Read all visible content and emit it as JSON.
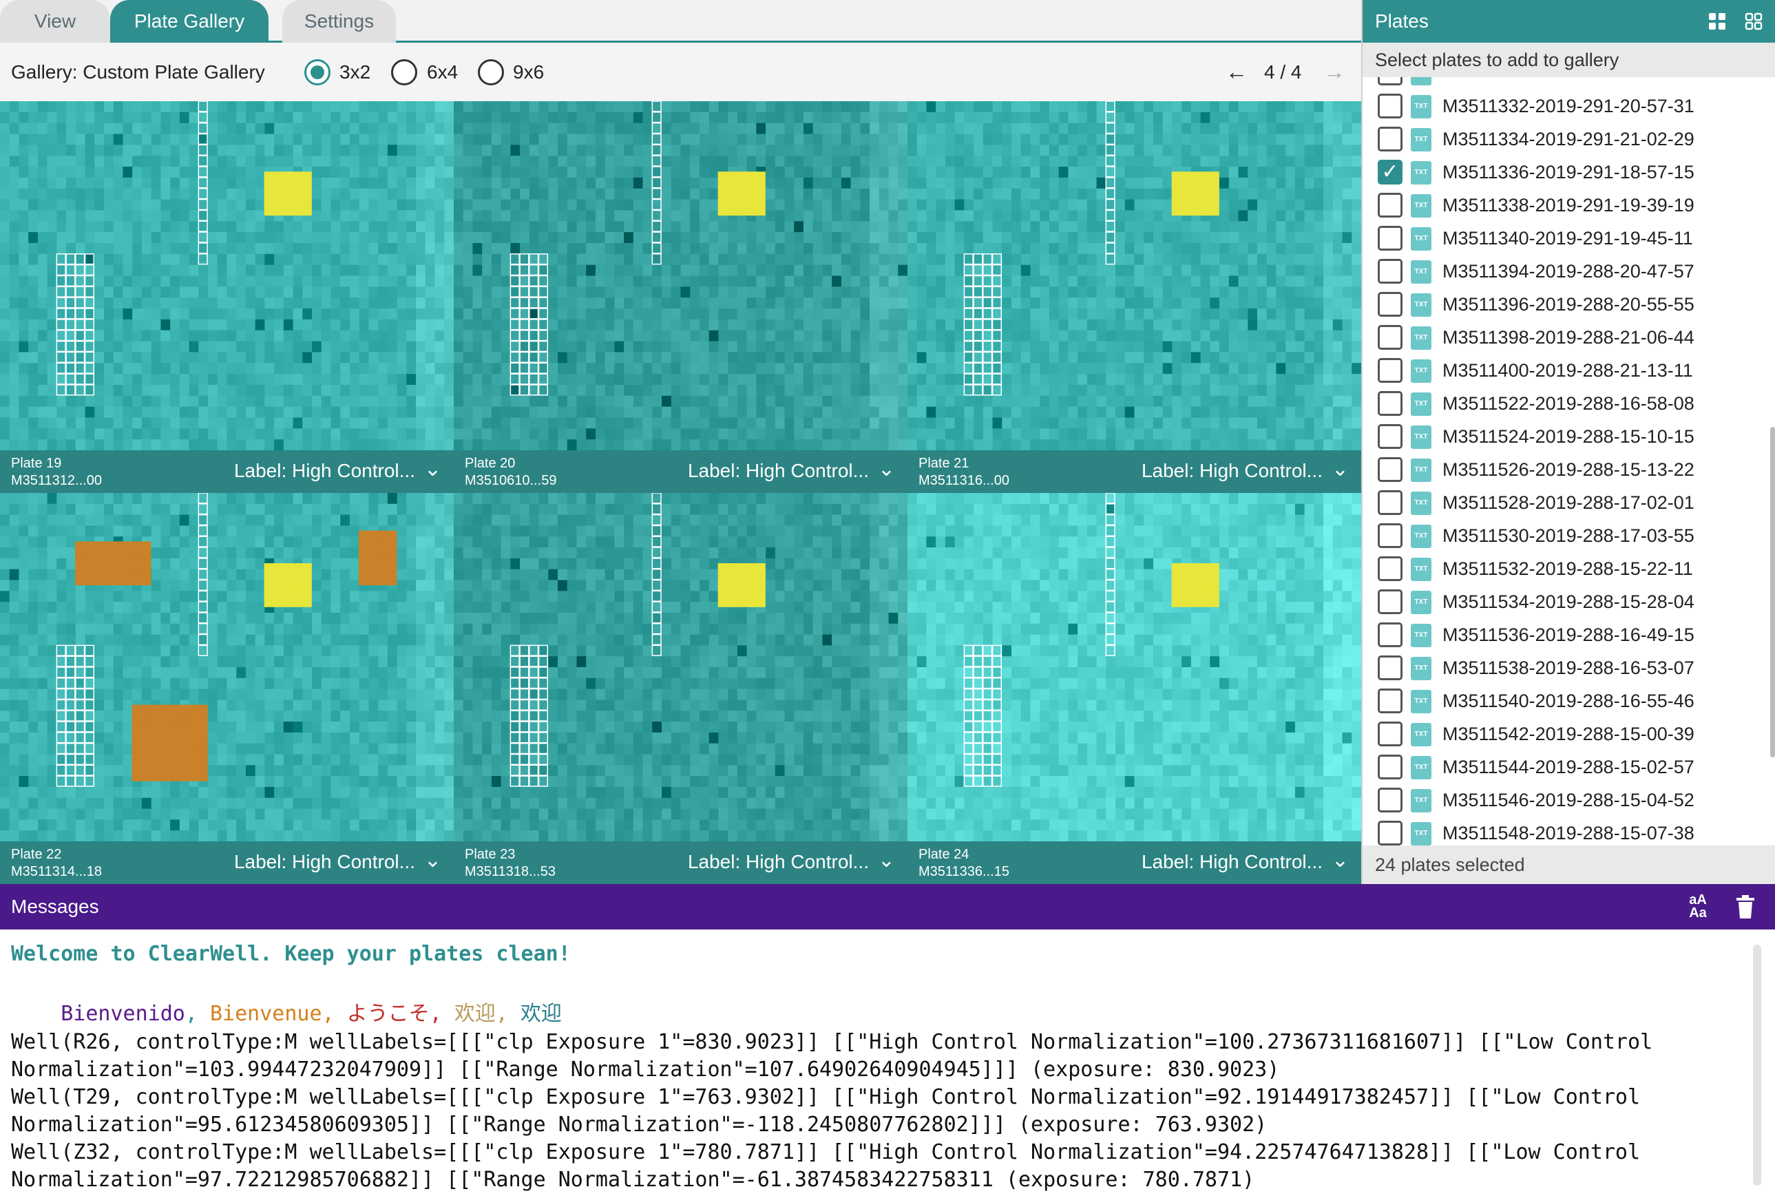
{
  "tabs": [
    {
      "label": "View",
      "active": false
    },
    {
      "label": "Plate Gallery",
      "active": true
    },
    {
      "label": "Settings",
      "active": false
    }
  ],
  "gallery": {
    "title": "Gallery: Custom Plate Gallery",
    "layouts": [
      {
        "label": "3x2",
        "selected": true
      },
      {
        "label": "6x4",
        "selected": false
      },
      {
        "label": "9x6",
        "selected": false
      }
    ],
    "page": "4 / 4"
  },
  "plates_grid": [
    {
      "name": "Plate 19",
      "id": "M3511312...00",
      "label": "Label: High Control...",
      "tone": "normal",
      "marks": [
        "yellow"
      ]
    },
    {
      "name": "Plate 20",
      "id": "M3510610...59",
      "label": "Label: High Control...",
      "tone": "dark",
      "marks": [
        "yellow"
      ]
    },
    {
      "name": "Plate 21",
      "id": "M3511316...00",
      "label": "Label: High Control...",
      "tone": "normal",
      "marks": [
        "yellow"
      ]
    },
    {
      "name": "Plate 22",
      "id": "M3511314...18",
      "label": "Label: High Control...",
      "tone": "normal",
      "marks": [
        "yellow",
        "orange"
      ]
    },
    {
      "name": "Plate 23",
      "id": "M3511318...53",
      "label": "Label: High Control...",
      "tone": "dark",
      "marks": [
        "yellow"
      ]
    },
    {
      "name": "Plate 24",
      "id": "M3511336...15",
      "label": "Label: High Control...",
      "tone": "light",
      "marks": [
        "yellow"
      ]
    }
  ],
  "plates_panel": {
    "title": "Plates",
    "subtitle": "Select plates to add to gallery",
    "items": [
      {
        "name": "M3511332-2019-291-20-57-31",
        "checked": false
      },
      {
        "name": "M3511334-2019-291-21-02-29",
        "checked": false
      },
      {
        "name": "M3511336-2019-291-18-57-15",
        "checked": true
      },
      {
        "name": "M3511338-2019-291-19-39-19",
        "checked": false
      },
      {
        "name": "M3511340-2019-291-19-45-11",
        "checked": false
      },
      {
        "name": "M3511394-2019-288-20-47-57",
        "checked": false
      },
      {
        "name": "M3511396-2019-288-20-55-55",
        "checked": false
      },
      {
        "name": "M3511398-2019-288-21-06-44",
        "checked": false
      },
      {
        "name": "M3511400-2019-288-21-13-11",
        "checked": false
      },
      {
        "name": "M3511522-2019-288-16-58-08",
        "checked": false
      },
      {
        "name": "M3511524-2019-288-15-10-15",
        "checked": false
      },
      {
        "name": "M3511526-2019-288-15-13-22",
        "checked": false
      },
      {
        "name": "M3511528-2019-288-17-02-01",
        "checked": false
      },
      {
        "name": "M3511530-2019-288-17-03-55",
        "checked": false
      },
      {
        "name": "M3511532-2019-288-15-22-11",
        "checked": false
      },
      {
        "name": "M3511534-2019-288-15-28-04",
        "checked": false
      },
      {
        "name": "M3511536-2019-288-16-49-15",
        "checked": false
      },
      {
        "name": "M3511538-2019-288-16-53-07",
        "checked": false
      },
      {
        "name": "M3511540-2019-288-16-55-46",
        "checked": false
      },
      {
        "name": "M3511542-2019-288-15-00-39",
        "checked": false
      },
      {
        "name": "M3511544-2019-288-15-02-57",
        "checked": false
      },
      {
        "name": "M3511546-2019-288-15-04-52",
        "checked": false
      },
      {
        "name": "M3511548-2019-288-15-07-38",
        "checked": false
      }
    ],
    "footer": "24 plates selected",
    "icons": [
      "grid-large-icon",
      "grid-small-icon"
    ]
  },
  "messages": {
    "title": "Messages",
    "welcome": "Welcome to ClearWell. Keep your plates clean!",
    "greetings": [
      {
        "text": "Bienvenido",
        "color": "#5a1a8c"
      },
      {
        "text": "Bienvenue",
        "color": "#d4801a"
      },
      {
        "text": "ようこそ",
        "color": "#c0302a"
      },
      {
        "text": "欢迎",
        "color": "#b89a5a"
      },
      {
        "text": "欢迎",
        "color": "#2a7f8c"
      }
    ],
    "lines": [
      "Well(R26, controlType:M wellLabels=[[[\"clp Exposure 1\"=830.9023]] [[\"High Control Normalization\"=100.27367311681607]] [[\"Low Control",
      "Normalization\"=103.99447232047909]] [[\"Range Normalization\"=107.64902640904945]]] (exposure: 830.9023)",
      "Well(T29, controlType:M wellLabels=[[[\"clp Exposure 1\"=763.9302]] [[\"High Control Normalization\"=92.19144917382457]] [[\"Low Control",
      "Normalization\"=95.61234580609305]] [[\"Range Normalization\"=-118.2450807762802]]] (exposure: 763.9302)",
      "Well(Z32, controlType:M wellLabels=[[[\"clp Exposure 1\"=780.7871]] [[\"High Control Normalization\"=94.22574764713828]] [[\"Low Control",
      "Normalization\"=97.72212985706882]] [[\"Range Normalization\"=-61.3874583422758311 (exposure: 780.7871)"
    ]
  },
  "colors": {
    "accent": "#2f8f8f",
    "messages_bar": "#4a1a8a",
    "well_marker_yellow": "#e8e63a",
    "well_marker_orange": "#c9822a"
  }
}
